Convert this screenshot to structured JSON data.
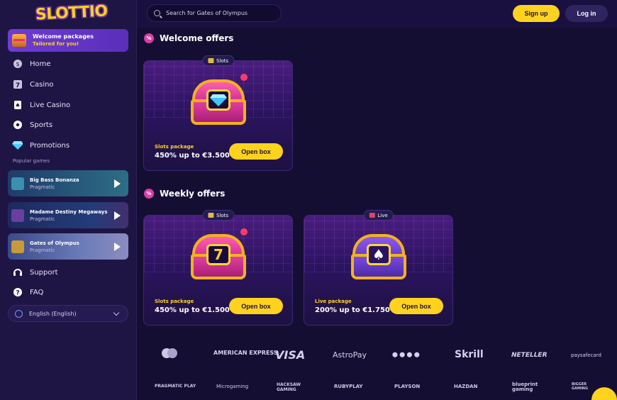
{
  "brand": {
    "logo_text": "SLOTTIO"
  },
  "topbar": {
    "search_prefix": "Search for",
    "search_placeholder": "Search for Gates of Olympus",
    "signup_label": "Sign up",
    "login_label": "Log in"
  },
  "sidebar": {
    "welcome": {
      "title": "Welcome packages",
      "subtitle": "Tailored for you!"
    },
    "nav": [
      {
        "label": "Home",
        "icon": "home-icon"
      },
      {
        "label": "Casino",
        "icon": "slot-icon"
      },
      {
        "label": "Live Casino",
        "icon": "cards-icon"
      },
      {
        "label": "Sports",
        "icon": "football-icon"
      },
      {
        "label": "Promotions",
        "icon": "diamond-icon"
      }
    ],
    "popular_label": "Popular games",
    "games": [
      {
        "name": "Big Bass Bonanza",
        "provider": "Pragmatic",
        "bg": "#2d6e86"
      },
      {
        "name": "Madame Destiny Megaways",
        "provider": "Pragmatic",
        "bg": "#243c7a"
      },
      {
        "name": "Gates of Olympus",
        "provider": "Pragmatic",
        "bg": "#5b6aa8"
      }
    ],
    "support_label": "Support",
    "faq_label": "FAQ",
    "language": "English (English)"
  },
  "sections": {
    "welcome_title": "Welcome offers",
    "weekly_title": "Weekly offers"
  },
  "offers": {
    "welcome": [
      {
        "tag": "Slots",
        "package": "Slots package",
        "value": "450% up to €3.500",
        "button": "Open box",
        "emblem": "diamond"
      }
    ],
    "weekly": [
      {
        "tag": "Slots",
        "package": "Slots package",
        "value": "450% up to €1.500",
        "button": "Open box",
        "emblem": "7"
      },
      {
        "tag": "Live",
        "package": "Live package",
        "value": "200% up to €1.750",
        "button": "Open box",
        "emblem": "♠"
      }
    ]
  },
  "payments": [
    "mastercard",
    "AMERICAN EXPRESS",
    "VISA",
    "AstroPay",
    "⬤ ⬤ ⬤ ⬤",
    "Skrill",
    "NETELLER",
    "paysafecard"
  ],
  "providers": [
    "PRAGMATIC PLAY",
    "Microgaming",
    "HACKSAW GAMING",
    "RUBYPLAY",
    "PLAYSON",
    "HAZDAN",
    "blueprint gaming",
    "BIGGER GAMING"
  ],
  "colors": {
    "accent": "#ffd21e",
    "bg": "#150e33",
    "sidebar": "#1e1545",
    "pink": "#d83fa5"
  }
}
